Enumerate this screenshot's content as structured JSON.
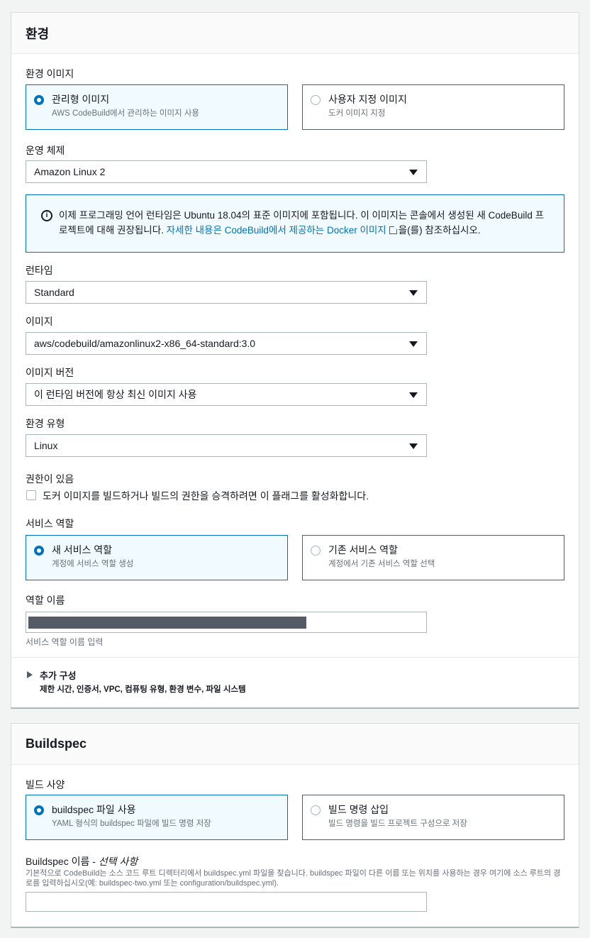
{
  "env": {
    "title": "환경",
    "image_label": "환경 이미지",
    "image_options": [
      {
        "title": "관리형 이미지",
        "desc": "AWS CodeBuild에서 관리하는 이미지 사용",
        "selected": true
      },
      {
        "title": "사용자 지정 이미지",
        "desc": "도커 이미지 지정",
        "selected": false
      }
    ],
    "os_label": "운영 체제",
    "os_value": "Amazon Linux 2",
    "info_text_1": "이제 프로그래밍 언어 런타임은 Ubuntu 18.04의 표준 이미지에 포함됩니다. 이 이미지는 콘솔에서 생성된 새 CodeBuild 프",
    "info_text_2": "로젝트에 대해 권장됩니다. ",
    "info_link": "자세한 내용은 CodeBuild에서 제공하는 Docker 이미지",
    "info_text_3": "을(를) 참조하십시오.",
    "runtime_label": "런타임",
    "runtime_value": "Standard",
    "image_select_label": "이미지",
    "image_value": "aws/codebuild/amazonlinux2-x86_64-standard:3.0",
    "image_version_label": "이미지 버전",
    "image_version_value": "이 런타임 버전에 항상 최신 이미지 사용",
    "env_type_label": "환경 유형",
    "env_type_value": "Linux",
    "privileged_label": "권한이 있음",
    "privileged_checkbox_label": "도커 이미지를 빌드하거나 빌드의 권한을 승격하려면 이 플래그를 활성화합니다.",
    "service_role_label": "서비스 역할",
    "service_role_options": [
      {
        "title": "새 서비스 역할",
        "desc": "계정에 서비스 역할 생성",
        "selected": true
      },
      {
        "title": "기존 서비스 역할",
        "desc": "계정에서 기존 서비스 역할 선택",
        "selected": false
      }
    ],
    "role_name_label": "역할 이름",
    "role_name_hint": "서비스 역할 이름 입력",
    "additional_title": "추가 구성",
    "additional_desc": "제한 시간, 인증서, VPC, 컴퓨팅 유형, 환경 변수, 파일 시스템"
  },
  "buildspec": {
    "title": "Buildspec",
    "spec_label": "빌드 사양",
    "spec_options": [
      {
        "title": "buildspec 파일 사용",
        "desc": "YAML 형식의 buildspec 파일에 빌드 명령 저장",
        "selected": true
      },
      {
        "title": "빌드 명령 삽입",
        "desc": "빌드 명령을 빌드 프로젝트 구성으로 저장",
        "selected": false
      }
    ],
    "name_label": "Buildspec 이름 - ",
    "name_label_optional": "선택 사항",
    "name_desc": "기본적으로 CodeBuild는 소스 코드 루트 디렉터리에서 buildspec.yml 파일을 찾습니다. buildspec 파일이 다른 이름 또는 위치를 사용하는 경우 여기에 소스 루트의 경로를 입력하십시오(예: buildspec-two.yml 또는 configuration/buildspec.yml).",
    "name_value": ""
  }
}
